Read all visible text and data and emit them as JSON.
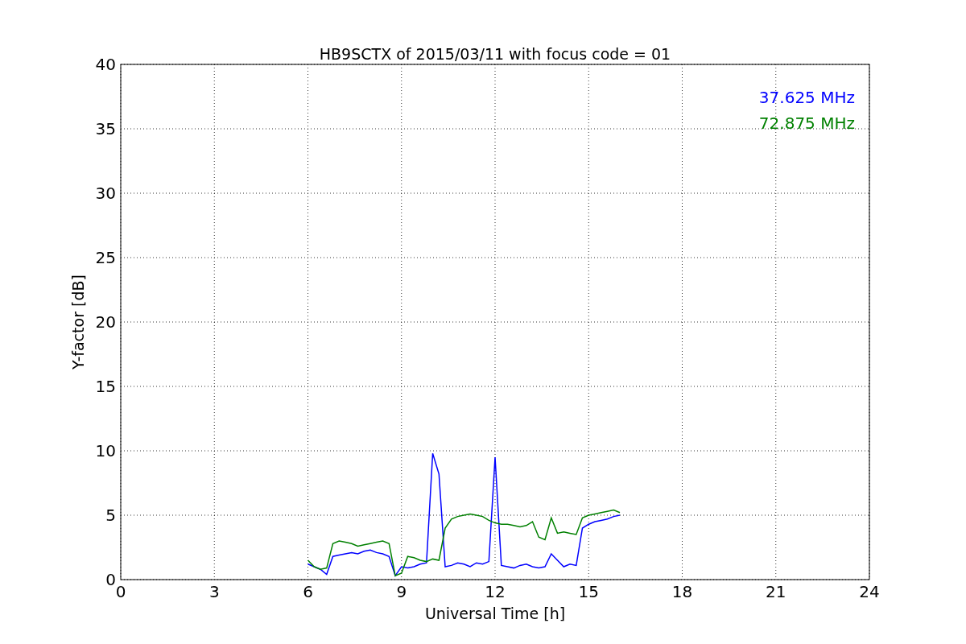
{
  "chart_data": {
    "type": "line",
    "title": "HB9SCTX of 2015/03/11 with focus code = 01",
    "xlabel": "Universal Time [h]",
    "ylabel": "Y-factor [dB]",
    "x": [
      6.0,
      6.2,
      6.4,
      6.6,
      6.8,
      7.0,
      7.2,
      7.4,
      7.6,
      7.8,
      8.0,
      8.2,
      8.4,
      8.6,
      8.8,
      9.0,
      9.2,
      9.4,
      9.6,
      9.8,
      10.0,
      10.2,
      10.4,
      10.6,
      10.8,
      11.0,
      11.2,
      11.4,
      11.6,
      11.8,
      12.0,
      12.2,
      12.4,
      12.6,
      12.8,
      13.0,
      13.2,
      13.4,
      13.6,
      13.8,
      14.0,
      14.2,
      14.4,
      14.6,
      14.8,
      15.0,
      15.2,
      15.4,
      15.6,
      15.8,
      16.0
    ],
    "series": [
      {
        "name": "37.625 MHz",
        "color": "#0000ff",
        "values": [
          1.2,
          1.0,
          0.8,
          0.4,
          1.8,
          1.9,
          2.0,
          2.1,
          2.0,
          2.2,
          2.3,
          2.1,
          2.0,
          1.8,
          0.3,
          1.0,
          0.9,
          1.0,
          1.2,
          1.3,
          9.8,
          8.2,
          1.0,
          1.1,
          1.3,
          1.2,
          1.0,
          1.3,
          1.2,
          1.4,
          9.5,
          1.1,
          1.0,
          0.9,
          1.1,
          1.2,
          1.0,
          0.9,
          1.0,
          2.0,
          1.5,
          1.0,
          1.2,
          1.1,
          4.0,
          4.3,
          4.5,
          4.6,
          4.7,
          4.9,
          5.0
        ]
      },
      {
        "name": "72.875 MHz",
        "color": "#008000",
        "values": [
          1.5,
          1.0,
          0.8,
          0.9,
          2.8,
          3.0,
          2.9,
          2.8,
          2.6,
          2.7,
          2.8,
          2.9,
          3.0,
          2.8,
          0.3,
          0.5,
          1.8,
          1.7,
          1.5,
          1.4,
          1.6,
          1.5,
          4.0,
          4.7,
          4.9,
          5.0,
          5.1,
          5.0,
          4.9,
          4.6,
          4.4,
          4.3,
          4.3,
          4.2,
          4.1,
          4.2,
          4.5,
          3.3,
          3.1,
          4.8,
          3.6,
          3.7,
          3.6,
          3.5,
          4.8,
          5.0,
          5.1,
          5.2,
          5.3,
          5.4,
          5.2
        ]
      }
    ],
    "grid": true,
    "xlim": [
      0,
      24
    ],
    "ylim": [
      0,
      40
    ],
    "xticks": [
      0,
      3,
      6,
      9,
      12,
      15,
      18,
      21,
      24
    ],
    "yticks": [
      0,
      5,
      10,
      15,
      20,
      25,
      30,
      35,
      40
    ]
  }
}
